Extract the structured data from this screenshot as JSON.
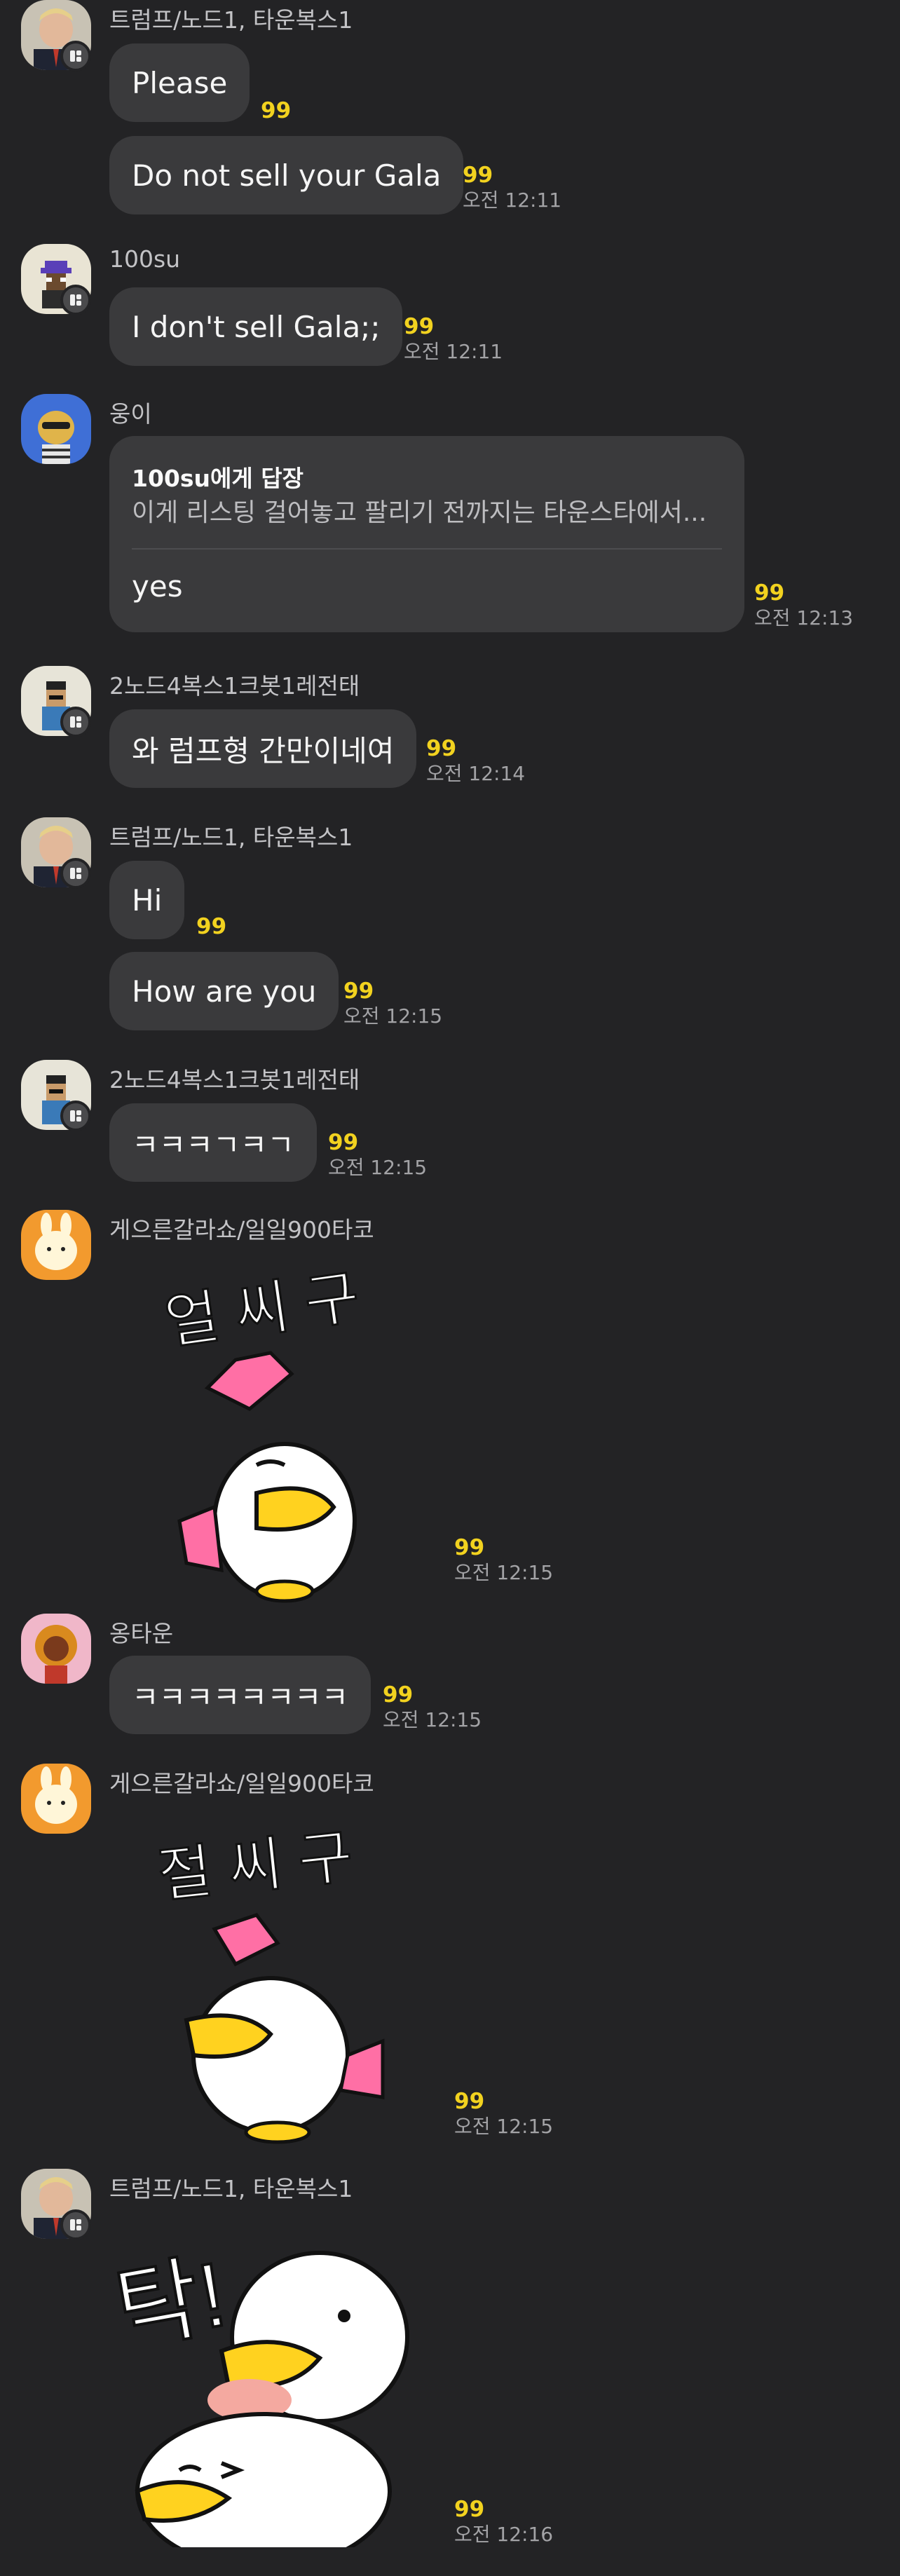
{
  "messages": [
    {
      "sender": "트럼프/노드1, 타운복스1",
      "lines": [
        {
          "text": "Please",
          "count": "99",
          "time": ""
        },
        {
          "text": "Do not sell your Gala",
          "count": "99",
          "time": "오전 12:11"
        }
      ]
    },
    {
      "sender": "100su",
      "lines": [
        {
          "text": "I don't sell Gala;;",
          "count": "99",
          "time": "오전 12:11"
        }
      ]
    },
    {
      "sender": "웅이",
      "reply": {
        "title": "100su에게 답장",
        "quote": "이게 리스팅 걸어놓고 팔리기 전까지는 타운스타에서...",
        "text": "yes"
      },
      "count": "99",
      "time": "오전 12:13"
    },
    {
      "sender": "2노드4복스1크봇1레전태",
      "lines": [
        {
          "text": "와 럼프형 간만이네여",
          "count": "99",
          "time": "오전 12:14"
        }
      ]
    },
    {
      "sender": "트럼프/노드1, 타운복스1",
      "lines": [
        {
          "text": "Hi",
          "count": "99",
          "time": ""
        },
        {
          "text": "How are you",
          "count": "99",
          "time": "오전 12:15"
        }
      ]
    },
    {
      "sender": "2노드4복스1크봇1레전태",
      "lines": [
        {
          "text": "ㅋㅋㅋㄱㅋㄱ",
          "count": "99",
          "time": "오전 12:15"
        }
      ]
    },
    {
      "sender": "게으른갈라쇼/일일900타코",
      "sticker": {
        "caption": "얼 씨 구"
      },
      "count": "99",
      "time": "오전 12:15"
    },
    {
      "sender": "옹타운",
      "lines": [
        {
          "text": "ㅋㅋㅋㅋㅋㅋㅋㅋ",
          "count": "99",
          "time": "오전 12:15"
        }
      ]
    },
    {
      "sender": "게으른갈라쇼/일일900타코",
      "sticker": {
        "caption": "절 씨 구"
      },
      "count": "99",
      "time": "오전 12:15"
    },
    {
      "sender": "트럼프/노드1, 타운복스1",
      "sticker": {
        "caption": "탁!"
      },
      "count": "99",
      "time": "오전 12:16"
    }
  ],
  "colors": {
    "background": "#232325",
    "bubble": "#3a3a3c",
    "unread": "#f2d21f",
    "time": "#a3a3a6"
  }
}
